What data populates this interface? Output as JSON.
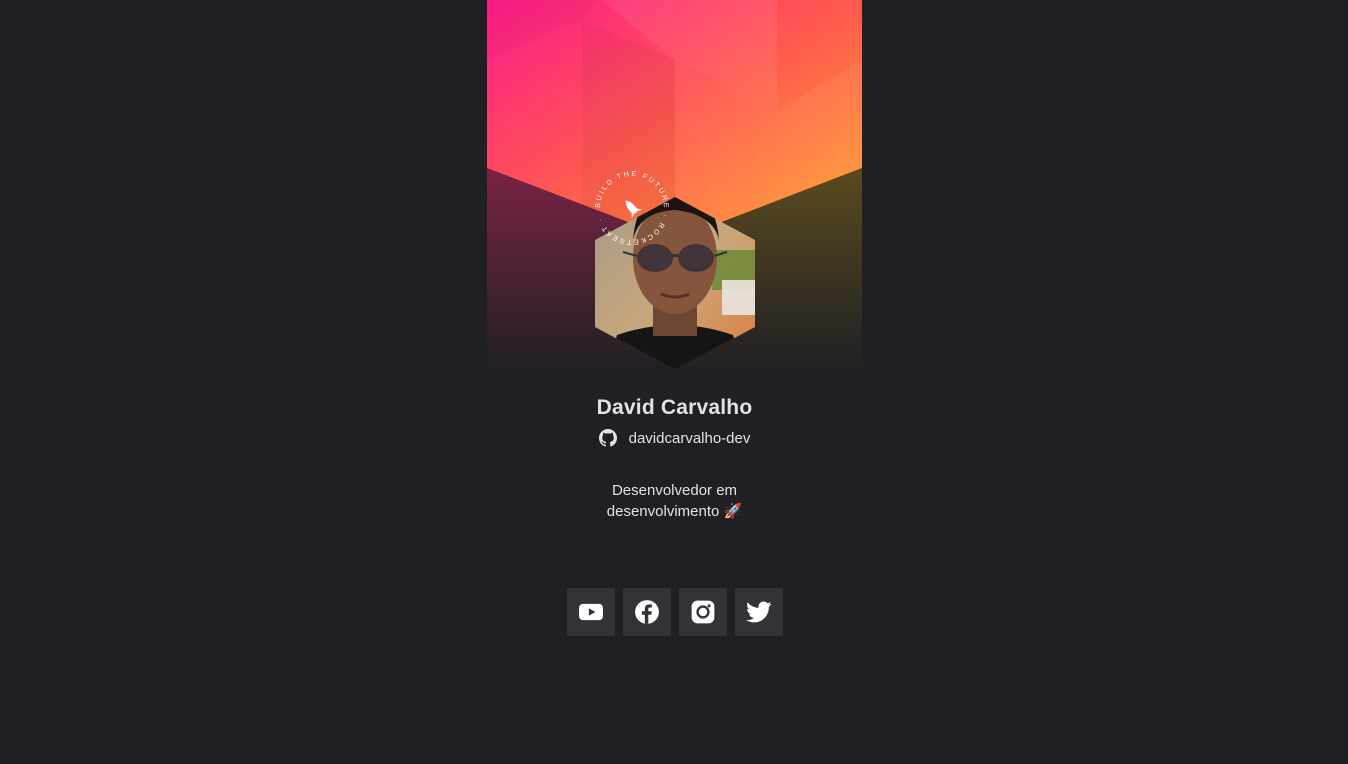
{
  "profile": {
    "name": "David Carvalho",
    "github_handle": "davidcarvalho-dev",
    "bio_line1": "Desenvolvedor em",
    "bio_line2": "desenvolvimento 🚀"
  },
  "stamp": {
    "text": "BUILD THE FUTURE · ROCKETSEAT ·"
  },
  "socials": [
    {
      "name": "youtube",
      "icon": "youtube-icon"
    },
    {
      "name": "facebook",
      "icon": "facebook-icon"
    },
    {
      "name": "instagram",
      "icon": "instagram-icon"
    },
    {
      "name": "twitter",
      "icon": "twitter-icon"
    }
  ],
  "colors": {
    "background": "#202024",
    "button_bg": "#323238",
    "text": "#e1e1e6",
    "gradient_start": "#ff1a8c",
    "gradient_mid": "#ff5a4f",
    "gradient_end": "#ffa52a"
  }
}
